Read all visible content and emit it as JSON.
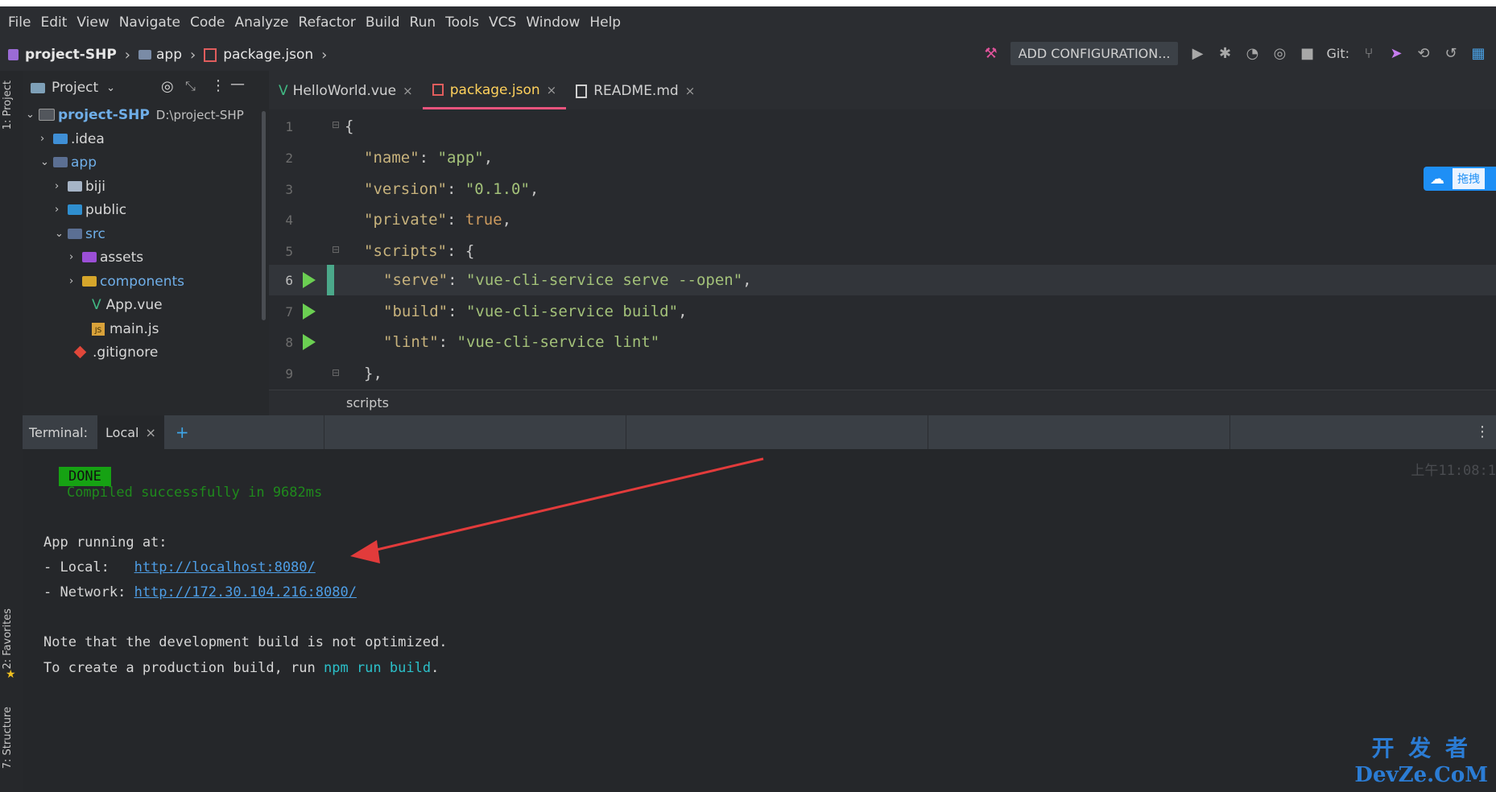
{
  "menu": [
    "File",
    "Edit",
    "View",
    "Navigate",
    "Code",
    "Analyze",
    "Refactor",
    "Build",
    "Run",
    "Tools",
    "VCS",
    "Window",
    "Help"
  ],
  "breadcrumb": {
    "project": "project-SHP",
    "folder": "app",
    "file": "package.json"
  },
  "toolbar": {
    "config_label": "ADD CONFIGURATION...",
    "git_label": "Git:"
  },
  "side_tabs": {
    "project": "1: Project",
    "favorites": "2: Favorites",
    "structure": "7: Structure"
  },
  "project_panel": {
    "title": "Project",
    "root": {
      "name": "project-SHP",
      "path": "D:\\project-SHP"
    },
    "items": [
      {
        "name": ".idea"
      },
      {
        "name": "app"
      },
      {
        "name": "biji"
      },
      {
        "name": "public"
      },
      {
        "name": "src"
      },
      {
        "name": "assets"
      },
      {
        "name": "components"
      },
      {
        "name": "App.vue"
      },
      {
        "name": "main.js"
      },
      {
        "name": ".gitignore"
      }
    ]
  },
  "editor": {
    "tabs": [
      {
        "label": "HelloWorld.vue"
      },
      {
        "label": "package.json"
      },
      {
        "label": "README.md"
      }
    ],
    "line_numbers": [
      "1",
      "2",
      "3",
      "4",
      "5",
      "6",
      "7",
      "8",
      "9"
    ],
    "breadcrumb": "scripts",
    "code": {
      "l1": "{",
      "name_key": "\"name\"",
      "name_val": "\"app\"",
      "version_key": "\"version\"",
      "version_val": "\"0.1.0\"",
      "private_key": "\"private\"",
      "private_val": "true",
      "scripts_key": "\"scripts\"",
      "serve_key": "\"serve\"",
      "serve_val": "\"vue-cli-service serve --open\"",
      "build_key": "\"build\"",
      "build_val": "\"vue-cli-service build\"",
      "lint_key": "\"lint\"",
      "lint_val": "\"vue-cli-service lint\"",
      "l9": "},"
    }
  },
  "terminal": {
    "label": "Terminal:",
    "tab": "Local",
    "done_badge": "DONE",
    "compiled": "Compiled successfully in 9682ms",
    "time": "上午11:08:1",
    "app_running": "App running at:",
    "local_label": "- Local:   ",
    "local_url": "http://localhost:8080/",
    "network_label": "- Network: ",
    "network_url": "http://172.30.104.216:8080/",
    "note": "Note that the development build is not optimized.",
    "prod_prefix": "To create a production build, run ",
    "prod_cmd": "npm run build",
    "prod_suffix": "."
  },
  "overlay_button": "拖拽",
  "watermark": {
    "line1": "开 发 者",
    "line2": "DevZe.CoM"
  },
  "colors": {
    "accent": "#e8537d",
    "run": "#6bcf52",
    "done": "#16a213",
    "link": "#4e9ee6"
  }
}
